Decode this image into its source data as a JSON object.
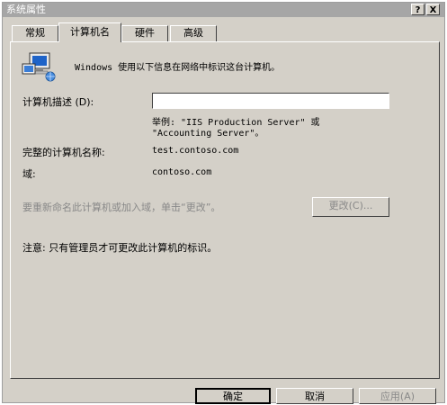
{
  "window": {
    "title": "系统属性",
    "help_btn": "?",
    "close_btn": "X"
  },
  "tabs": [
    {
      "label": "常规"
    },
    {
      "label": "计算机名"
    },
    {
      "label": "硬件"
    },
    {
      "label": "高级"
    }
  ],
  "content": {
    "intro": "Windows 使用以下信息在网络中标识这台计算机。",
    "description_label": "计算机描述 (D):",
    "description_value": "",
    "example_line1": "举例: \"IIS Production Server\" 或",
    "example_line2": "\"Accounting Server\"。",
    "fullname_label": "完整的计算机名称:",
    "fullname_value": "test.contoso.com",
    "domain_label": "域:",
    "domain_value": "contoso.com",
    "rename_text": "要重新命名此计算机或加入域，单击“更改”。",
    "change_button": "更改(C)...",
    "note": "注意: 只有管理员才可更改此计算机的标识。"
  },
  "footer": {
    "ok": "确定",
    "cancel": "取消",
    "apply": "应用(A)"
  },
  "icons": {
    "computer": "computer-network-icon"
  }
}
